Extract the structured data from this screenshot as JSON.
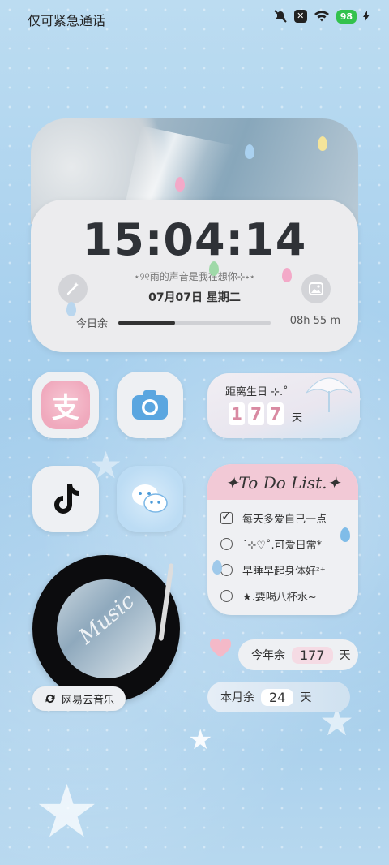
{
  "status_bar": {
    "carrier": "仅可紧急通话",
    "battery": "98"
  },
  "clock_widget": {
    "time": "15:04:14",
    "lyric": "⋆୨୧雨的声音是我在想你⊹˖⋆",
    "date": "07月07日  星期二",
    "day_label": "今日余",
    "day_remaining": "08h 55 m",
    "day_progress": 0.37
  },
  "apps": {
    "alipay": {
      "glyph": "支",
      "icon": "alipay-icon"
    },
    "camera": {
      "icon": "camera-icon"
    },
    "tiktok": {
      "icon": "tiktok-icon"
    },
    "wechat": {
      "icon": "wechat-icon"
    }
  },
  "birthday_widget": {
    "title": "距离生日 ⊹.˚",
    "digits": [
      "1",
      "7",
      "7"
    ],
    "unit": "天"
  },
  "todo_widget": {
    "title": "✦To Do List.✦",
    "items": [
      {
        "text": "每天多爱自己一点",
        "checked": true
      },
      {
        "text": "˙⊹♡˚.可爱日常*",
        "checked": false
      },
      {
        "text": "早睡早起身体好ᶻ⁺",
        "checked": false
      },
      {
        "text": "★.要喝八杯水~",
        "checked": false
      }
    ]
  },
  "music_widget": {
    "disc_text": "Music",
    "label": "网易云音乐"
  },
  "year_widget": {
    "prefix": "今年余",
    "value": "177",
    "unit": "天",
    "accent": "#f5dbe4"
  },
  "month_widget": {
    "prefix": "本月余",
    "value": "24",
    "unit": "天",
    "accent": "#ffffff"
  }
}
